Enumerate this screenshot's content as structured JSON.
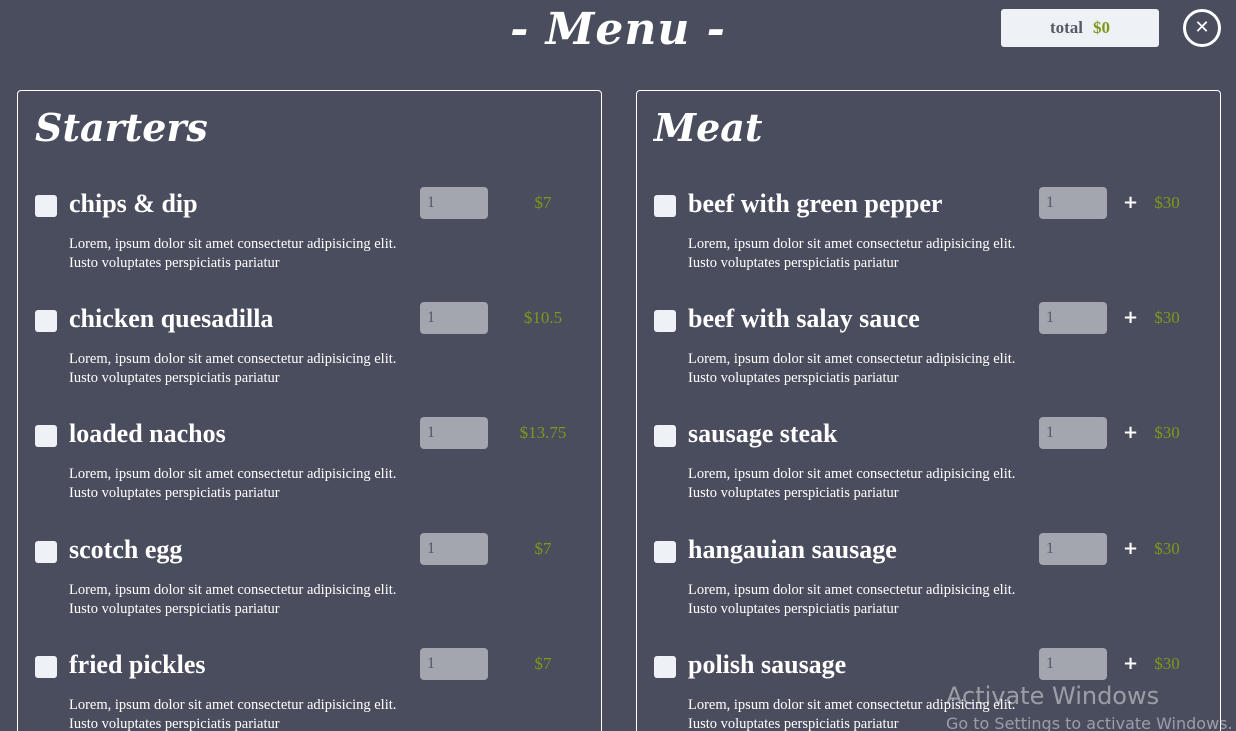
{
  "header": {
    "title": "- Menu -",
    "total_label": "total",
    "total_value": "$0",
    "close_glyph": "✕"
  },
  "colors": {
    "background": "#4a4d5d",
    "price_green": "#7a9a1a",
    "input_gray": "#a3a6af",
    "checkbox_fill": "#eef1f6"
  },
  "starters": {
    "heading": "Starters",
    "items": [
      {
        "name": "chips & dip",
        "qty": "1",
        "price": "$7",
        "desc": "Lorem, ipsum dolor sit amet consectetur adipisicing elit. Iusto voluptates perspiciatis pariatur"
      },
      {
        "name": "chicken quesadilla",
        "qty": "1",
        "price": "$10.5",
        "desc": "Lorem, ipsum dolor sit amet consectetur adipisicing elit. Iusto voluptates perspiciatis pariatur"
      },
      {
        "name": "loaded nachos",
        "qty": "1",
        "price": "$13.75",
        "desc": "Lorem, ipsum dolor sit amet consectetur adipisicing elit. Iusto voluptates perspiciatis pariatur"
      },
      {
        "name": "scotch egg",
        "qty": "1",
        "price": "$7",
        "desc": "Lorem, ipsum dolor sit amet consectetur adipisicing elit. Iusto voluptates perspiciatis pariatur"
      },
      {
        "name": "fried pickles",
        "qty": "1",
        "price": "$7",
        "desc": "Lorem, ipsum dolor sit amet consectetur adipisicing elit. Iusto voluptates perspiciatis pariatur"
      }
    ]
  },
  "meat": {
    "heading": "Meat",
    "plus": "+",
    "items": [
      {
        "name": "beef with green pepper",
        "qty": "1",
        "price": "$30",
        "desc": "Lorem, ipsum dolor sit amet consectetur adipisicing elit. Iusto voluptates perspiciatis pariatur"
      },
      {
        "name": "beef with salay sauce",
        "qty": "1",
        "price": "$30",
        "desc": "Lorem, ipsum dolor sit amet consectetur adipisicing elit. Iusto voluptates perspiciatis pariatur"
      },
      {
        "name": "sausage steak",
        "qty": "1",
        "price": "$30",
        "desc": "Lorem, ipsum dolor sit amet consectetur adipisicing elit. Iusto voluptates perspiciatis pariatur"
      },
      {
        "name": "hangauian sausage",
        "qty": "1",
        "price": "$30",
        "desc": "Lorem, ipsum dolor sit amet consectetur adipisicing elit. Iusto voluptates perspiciatis pariatur"
      },
      {
        "name": "polish sausage",
        "qty": "1",
        "price": "$30",
        "desc": "Lorem, ipsum dolor sit amet consectetur adipisicing elit. Iusto voluptates perspiciatis pariatur"
      }
    ]
  },
  "watermark": {
    "title": "Activate Windows",
    "subtitle": "Go to Settings to activate Windows."
  }
}
